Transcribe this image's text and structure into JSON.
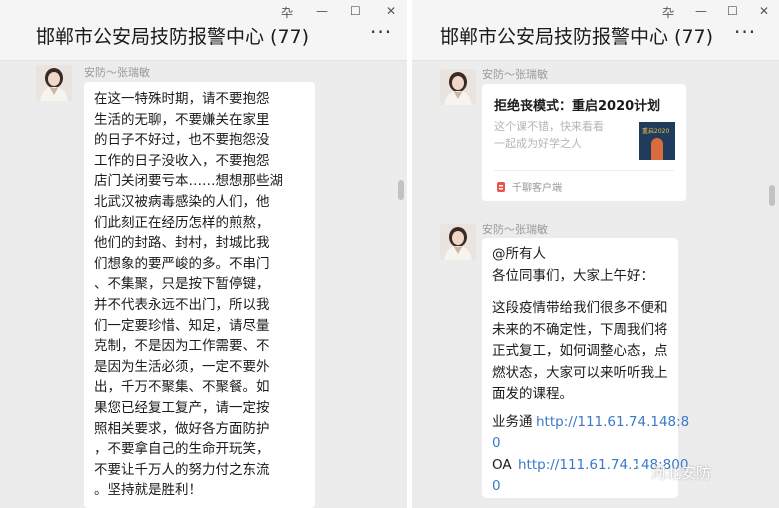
{
  "window_controls": {
    "pin": "卆",
    "minimize": "—",
    "maximize": "☐",
    "close": "✕"
  },
  "left": {
    "title": "邯郸市公安局技防报警中心 (77)",
    "more": "···",
    "message": {
      "sender": "安防～张瑞敏",
      "lines": [
        "在这一特殊时期，请不要抱怨",
        "生活的无聊，不要嫌关在家里",
        "的日子不好过，也不要抱怨没",
        "工作的日子没收入，不要抱怨",
        "店门关闭要亏本……想想那些湖",
        "北武汉被病毒感染的人们，他",
        "们此刻正在经历怎样的煎熬，",
        "他们的封路、封村，封城比我",
        "们想象的要严峻的多。不串门",
        "、不集聚，只是按下暂停键，",
        "并不代表永远不出门，所以我",
        "们一定要珍惜、知足，请尽量",
        "克制，不是因为工作需要、不",
        "是因为生活必须，一定不要外",
        "出，千万不聚集、不聚餐。如",
        "果您已经复工复产，请一定按",
        "照相关要求，做好各方面防护",
        "，不要拿自己的生命开玩笑，",
        "不要让千万人的努力付之东流",
        "。坚持就是胜利！"
      ]
    }
  },
  "right": {
    "title": "邯郸市公安局技防报警中心 (77)",
    "more": "···",
    "card_message": {
      "sender": "安防～张瑞敏",
      "title": "拒绝丧模式：重启2020计划",
      "desc1": "这个课不错，快来看看",
      "desc2": "一起成为好学之人",
      "source": "千聊客户端",
      "thumb_text": "重启2020"
    },
    "text_message": {
      "sender": "安防～张瑞敏",
      "line1": "@所有人",
      "line2": "各位同事们，大家上午好：",
      "para": [
        "这段疫情带给我们很多不便和",
        "未来的不确定性，下周我们将",
        "正式复工，如何调整心态，点",
        "燃状态，大家可以来听听我上",
        "面发的课程。"
      ],
      "link1_label": "业务通",
      "link1_url": "http://111.61.74.148:8",
      "link1_tail": "0",
      "link2_label": "OA",
      "link2_url": "http://111.61.74.148:800",
      "link2_tail": "0"
    }
  },
  "watermark": "河北安防"
}
